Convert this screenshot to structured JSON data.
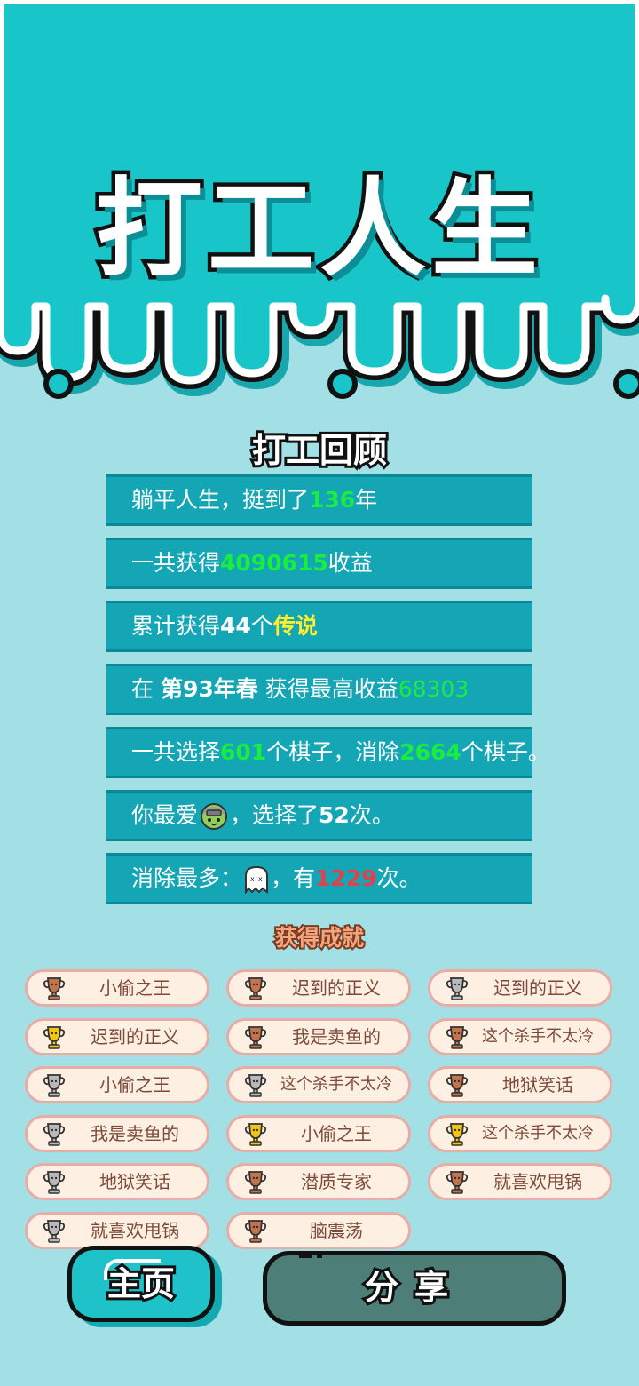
{
  "title": "打工人生",
  "review": {
    "heading": "打工回顾",
    "rows": [
      {
        "p1": "躺平人生，挺到了",
        "v": "136",
        "p2": "年"
      },
      {
        "p1": "一共获得",
        "v": "4090615",
        "p2": "收益"
      },
      {
        "p1": "累计获得",
        "v": "44",
        "p2": "个",
        "v2": "传说"
      },
      {
        "p1": "在 ",
        "v": "第93年春",
        "p2": " 获得最高收益",
        "v2": "68303"
      },
      {
        "p1": "一共选择",
        "v": "601",
        "p2": "个棋子，消除",
        "v2": "2664",
        "p3": "个棋子。"
      },
      {
        "p1": "你最爱",
        "icon": "green-slime-piece-icon",
        "p2": "，选择了",
        "v": "52",
        "p3": "次。"
      },
      {
        "p1": "消除最多：",
        "icon": "ghost-piece-icon",
        "p2": "，有",
        "v": "1229",
        "p3": "次。"
      }
    ]
  },
  "achievements": {
    "heading": "获得成就",
    "items": [
      {
        "label": "小偷之王",
        "tier": "bronze"
      },
      {
        "label": "迟到的正义",
        "tier": "bronze"
      },
      {
        "label": "迟到的正义",
        "tier": "silver"
      },
      {
        "label": "迟到的正义",
        "tier": "gold"
      },
      {
        "label": "我是卖鱼的",
        "tier": "bronze"
      },
      {
        "label": "这个杀手不太冷",
        "tier": "bronze"
      },
      {
        "label": "小偷之王",
        "tier": "silver"
      },
      {
        "label": "这个杀手不太冷",
        "tier": "silver"
      },
      {
        "label": "地狱笑话",
        "tier": "bronze"
      },
      {
        "label": "我是卖鱼的",
        "tier": "silver"
      },
      {
        "label": "小偷之王",
        "tier": "gold"
      },
      {
        "label": "这个杀手不太冷",
        "tier": "gold"
      },
      {
        "label": "地狱笑话",
        "tier": "silver"
      },
      {
        "label": "潜质专家",
        "tier": "bronze"
      },
      {
        "label": "就喜欢甩锅",
        "tier": "bronze"
      },
      {
        "label": "就喜欢甩锅",
        "tier": "silver"
      },
      {
        "label": "脑震荡",
        "tier": "bronze"
      }
    ]
  },
  "buttons": {
    "home": "主页",
    "share": "分享"
  },
  "colors": {
    "header_teal": "#18c6c9",
    "background": "#a3e0e6",
    "row_bg": "#14a6b5",
    "value_green": "#19ee3f",
    "legend_yellow": "#ffef2e",
    "count_red": "#e2404c",
    "share_button": "#4d7e78",
    "gold": "#f3c613",
    "silver": "#b9b9b9",
    "bronze": "#c4744d"
  }
}
